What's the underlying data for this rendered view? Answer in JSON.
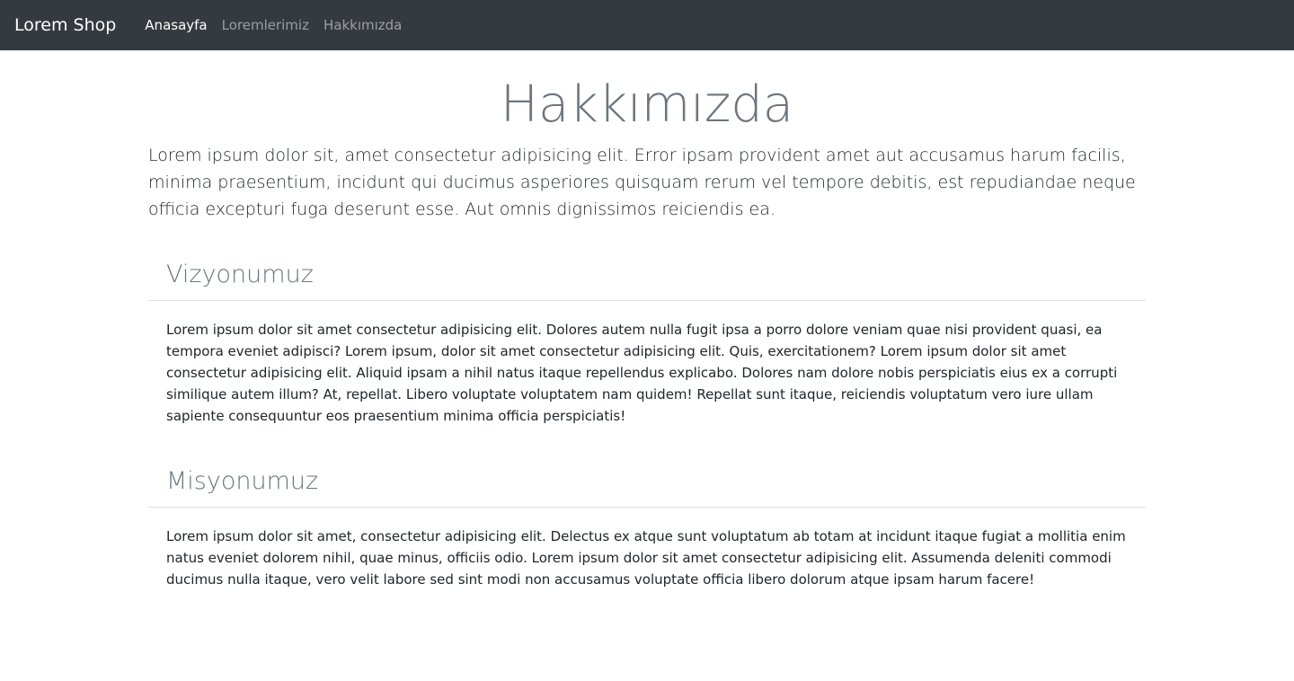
{
  "navbar": {
    "brand": "Lorem Shop",
    "links": [
      {
        "label": "Anasayfa",
        "active": true
      },
      {
        "label": "Loremlerimiz",
        "active": false
      },
      {
        "label": "Hakkımızda",
        "active": false
      }
    ]
  },
  "page": {
    "title": "Hakkımızda",
    "lead": "Lorem ipsum dolor sit, amet consectetur adipisicing elit. Error ipsam provident amet aut accusamus harum facilis, minima praesentium, incidunt qui ducimus asperiores quisquam rerum vel tempore debitis, est repudiandae neque officia excepturi fuga deserunt esse. Aut omnis dignissimos reiciendis ea."
  },
  "sections": [
    {
      "heading": "Vizyonumuz",
      "body": "Lorem ipsum dolor sit amet consectetur adipisicing elit. Dolores autem nulla fugit ipsa a porro dolore veniam quae nisi provident quasi, ea tempora eveniet adipisci? Lorem ipsum, dolor sit amet consectetur adipisicing elit. Quis, exercitationem? Lorem ipsum dolor sit amet consectetur adipisicing elit. Aliquid ipsam a nihil natus itaque repellendus explicabo. Dolores nam dolore nobis perspiciatis eius ex a corrupti similique autem illum? At, repellat. Libero voluptate voluptatem nam quidem! Repellat sunt itaque, reiciendis voluptatum vero iure ullam sapiente consequuntur eos praesentium minima officia perspiciatis!"
    },
    {
      "heading": "Misyonumuz",
      "body": "Lorem ipsum dolor sit amet, consectetur adipisicing elit. Delectus ex atque sunt voluptatum ab totam at incidunt itaque fugiat a mollitia enim natus eveniet dolorem nihil, quae minus, officiis odio. Lorem ipsum dolor sit amet consectetur adipisicing elit. Assumenda deleniti commodi ducimus nulla itaque, vero velit labore sed sint modi non accusamus voluptate officia libero dolorum atque ipsam harum facere!"
    }
  ],
  "colors": {
    "navbar_bg": "#343a40",
    "muted_heading": "#6c757d",
    "divider": "#dee2e6",
    "body_text": "#212529"
  }
}
